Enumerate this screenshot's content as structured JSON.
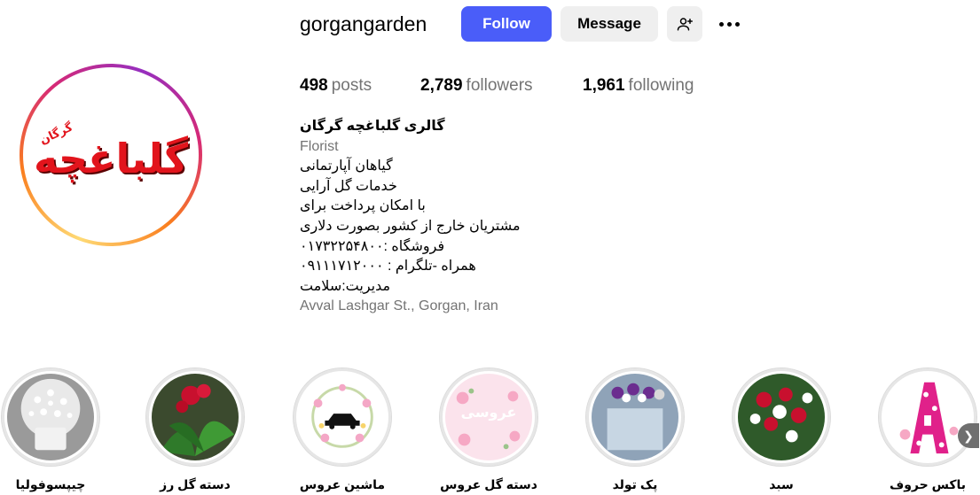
{
  "profile": {
    "username": "gorgangarden",
    "logo_text": "گلباغچه",
    "logo_subtext": "گرگان"
  },
  "actions": {
    "follow_label": "Follow",
    "message_label": "Message",
    "suggest_icon": "add-person-icon",
    "more_icon": "more-dots-icon"
  },
  "stats": {
    "posts_count": "498",
    "posts_label": "posts",
    "followers_count": "2,789",
    "followers_label": "followers",
    "following_count": "1,961",
    "following_label": "following"
  },
  "bio": {
    "name": "گالری گلباغچه گرگان",
    "category": "Florist",
    "lines": [
      "گیاهان آپارتمانی",
      "خدمات گل آرایی",
      "با امکان پرداخت برای",
      "مشتریان خارج از کشور بصورت دلاری",
      "فروشگاه :۰۱۷۳۲۲۵۴۸۰۰",
      "همراه -تلگرام : ۰۹۱۱۱۷۱۲۰۰۰",
      "مدیریت:سلامت"
    ],
    "address": "Avval Lashgar St., Gorgan, Iran"
  },
  "highlights": [
    {
      "label": "چیپسوفولیا",
      "theme": "gypsophila"
    },
    {
      "label": "دسته گل رز",
      "theme": "rose-bouquet"
    },
    {
      "label": "ماشین عروس",
      "theme": "wedding-car"
    },
    {
      "label": "دسته گل عروس",
      "theme": "bridal-bouquet",
      "inner_text": "عروسی"
    },
    {
      "label": "پک تولد",
      "theme": "birthday-pack"
    },
    {
      "label": "سبد",
      "theme": "basket"
    },
    {
      "label": "باکس حروف",
      "theme": "letter-box"
    }
  ],
  "colors": {
    "follow_bg": "#4a5df9",
    "secondary_bg": "#efefef",
    "muted_text": "#737373",
    "logo_red": "#e2141c"
  }
}
